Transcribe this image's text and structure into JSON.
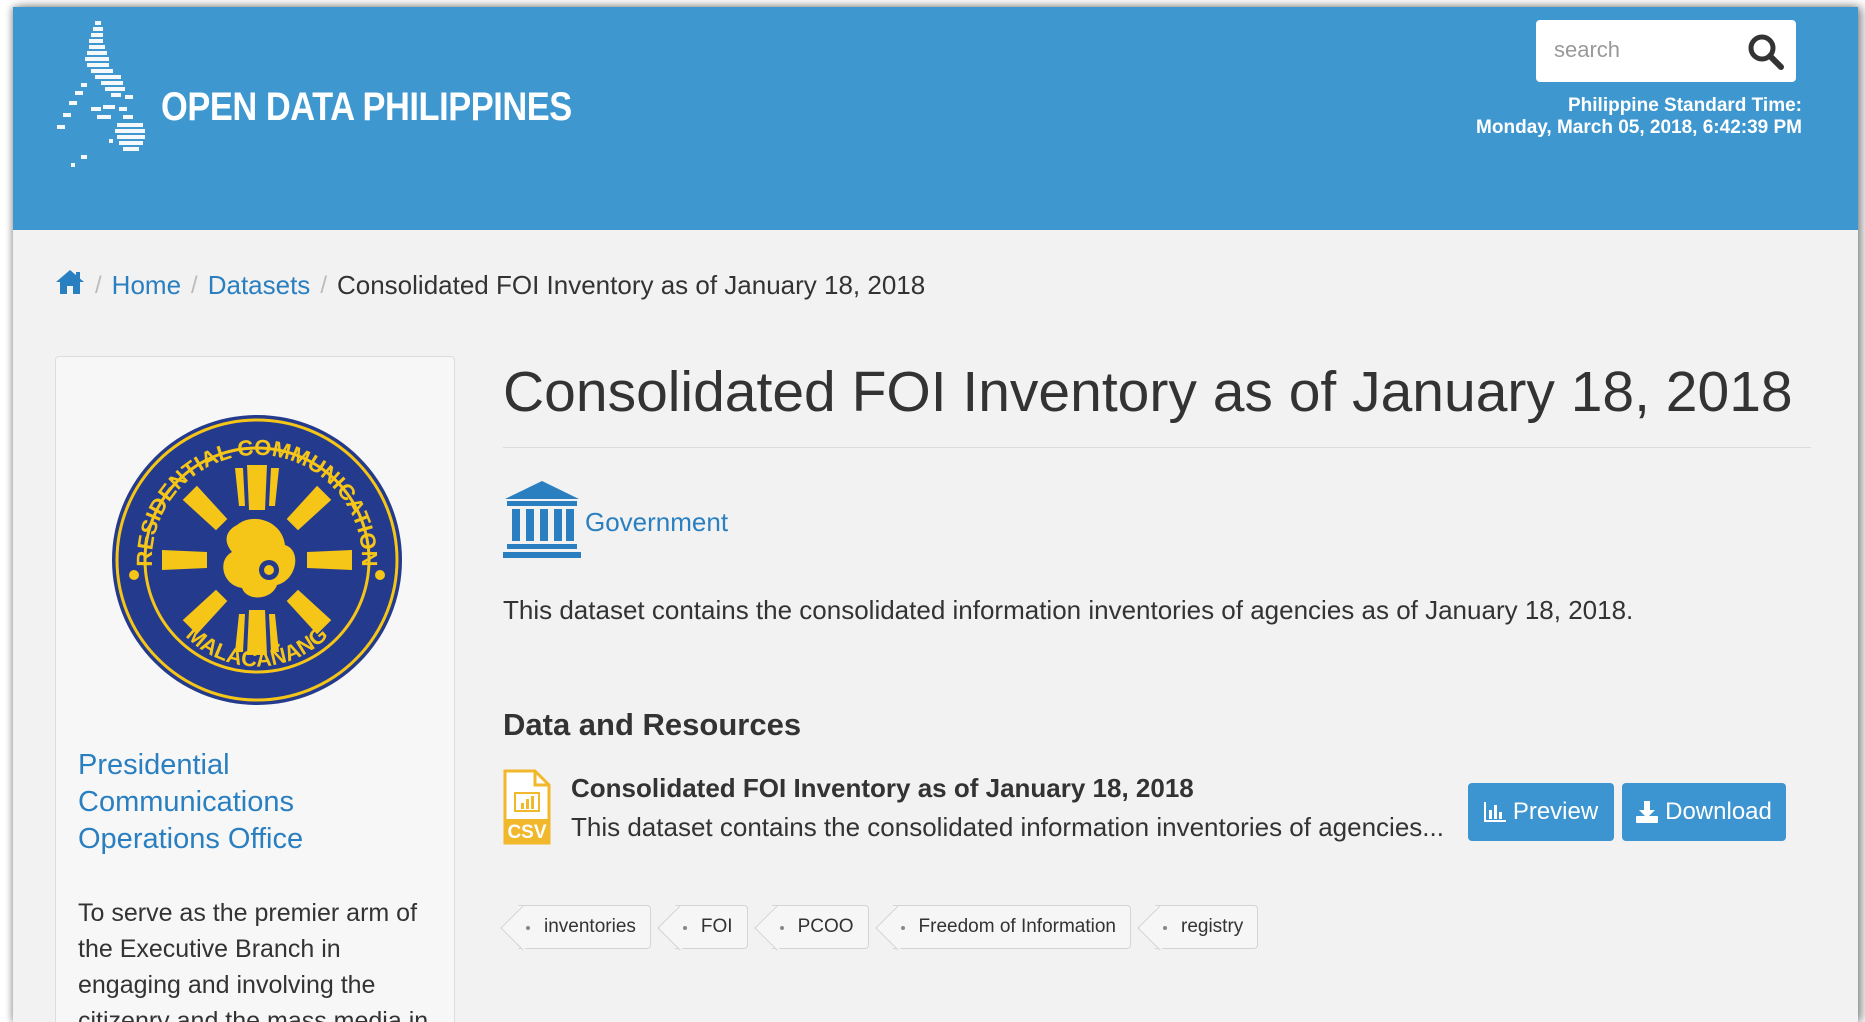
{
  "header": {
    "site_title": "OPEN DATA PHILIPPINES",
    "search": {
      "placeholder": "search"
    },
    "pst_label": "Philippine Standard Time:",
    "pst_value": "Monday, March 05, 2018, 6:42:39 PM"
  },
  "breadcrumb": {
    "home": "Home",
    "datasets": "Datasets",
    "current": "Consolidated FOI Inventory as of January 18, 2018"
  },
  "organization": {
    "seal_text_top": "PRESIDENTIAL COMMUNICATIONS",
    "seal_text_bottom": "MALACAÑANG",
    "name": "Presidential Communications Operations Office",
    "description": "To serve as the premier arm of the Executive Branch in engaging and involving the citizenry and the mass media in"
  },
  "dataset": {
    "title": "Consolidated FOI Inventory as of January 18, 2018",
    "group": "Government",
    "description": "This dataset contains the consolidated information inventories of agencies as of January 18, 2018."
  },
  "resources": {
    "heading": "Data and Resources",
    "items": [
      {
        "format": "CSV",
        "title": "Consolidated FOI Inventory as of January 18, 2018",
        "description": "This dataset contains the consolidated information inventories of agencies...",
        "preview_label": "Preview",
        "download_label": "Download"
      }
    ]
  },
  "tags": [
    "inventories",
    "FOI",
    "PCOO",
    "Freedom of Information",
    "registry"
  ],
  "colors": {
    "header_bg": "#3e98cf",
    "link": "#2a7fc0",
    "button": "#3c95d0",
    "csv_icon": "#f0b82a",
    "seal_blue": "#243a8c",
    "seal_gold": "#f5c518"
  },
  "icons": [
    "philippines-map-icon",
    "search-icon",
    "home-icon",
    "government-building-icon",
    "csv-file-icon",
    "bar-chart-icon",
    "download-icon"
  ]
}
